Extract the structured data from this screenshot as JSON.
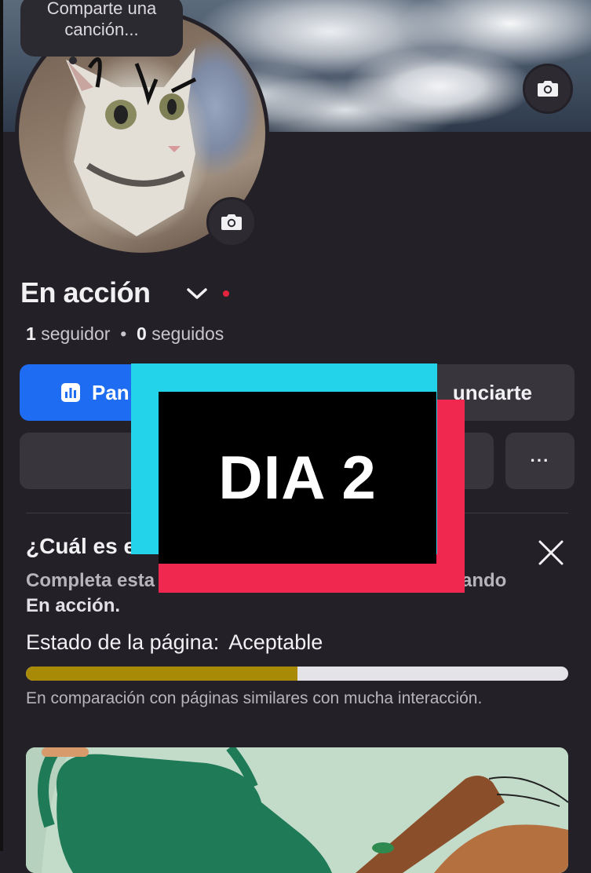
{
  "tooltip": {
    "text": "Comparte una canción..."
  },
  "profile": {
    "name": "En acción",
    "followers_count": "1",
    "followers_label": "seguidor",
    "separator": "•",
    "following_count": "0",
    "following_label": "seguidos"
  },
  "actions": {
    "primary_label": "Pan",
    "secondary_label": "unciarte",
    "more_label": "···"
  },
  "card": {
    "title": "¿Cuál es e",
    "body_start": "Completa esta",
    "body_end": "ando",
    "page_name": "En acción.",
    "health_label": "Estado de la página:",
    "health_value": "Aceptable",
    "health_progress": 0.5,
    "comparison": "En comparación con páginas similares con mucha interacción."
  },
  "overlay": {
    "text": "DIA 2"
  },
  "colors": {
    "accent": "#1d6cf2",
    "progress": "#a98a07",
    "notification_dot": "#e4253b",
    "sticker_cyan": "#22d3ea",
    "sticker_red": "#f0284f"
  }
}
